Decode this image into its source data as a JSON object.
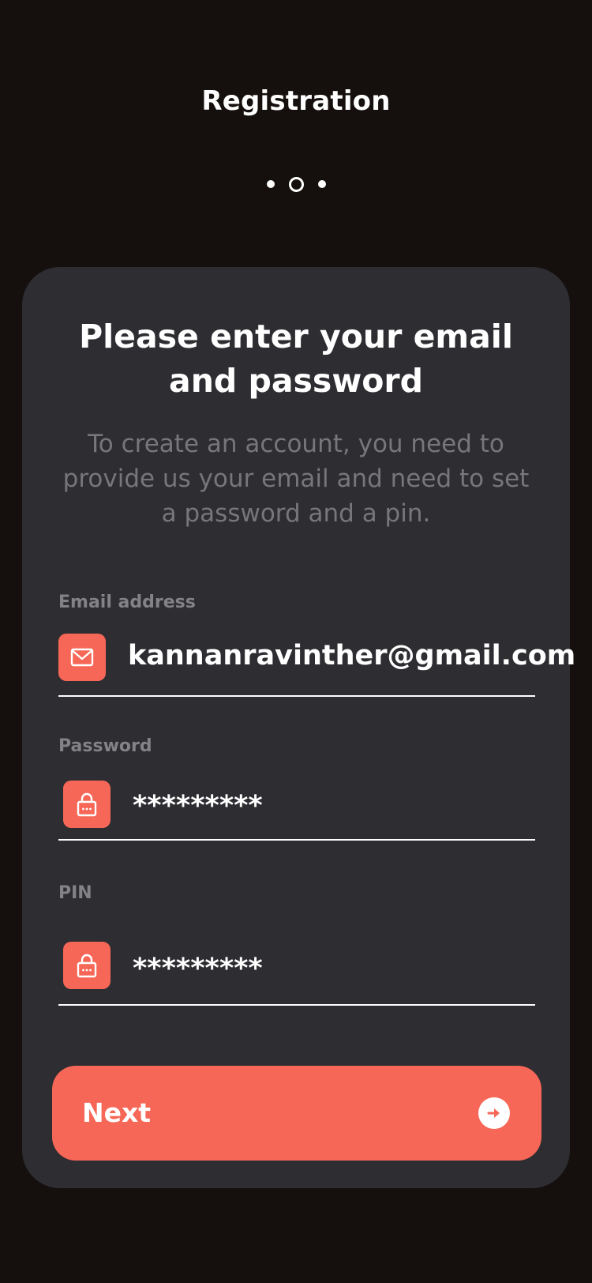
{
  "header": {
    "title": "Registration",
    "steps_total": 3,
    "current_step": 2
  },
  "card": {
    "headline": "Please enter your email and password",
    "description": "To create an account, you need to provide us your email and need to set a password and  a pin."
  },
  "form": {
    "email": {
      "label": "Email address",
      "value": "kannanravinther@gmail.com",
      "icon": "mail-icon"
    },
    "password": {
      "label": "Password",
      "value": "*********",
      "icon": "lock-icon"
    },
    "pin": {
      "label": "PIN",
      "value": "*********",
      "icon": "lock-icon"
    }
  },
  "actions": {
    "next_label": "Next",
    "next_icon": "arrow-right-circle-icon"
  },
  "colors": {
    "background": "#15100d",
    "card": "#2e2d32",
    "accent": "#f66757",
    "muted_text": "#77767a",
    "label_text": "#838286"
  }
}
